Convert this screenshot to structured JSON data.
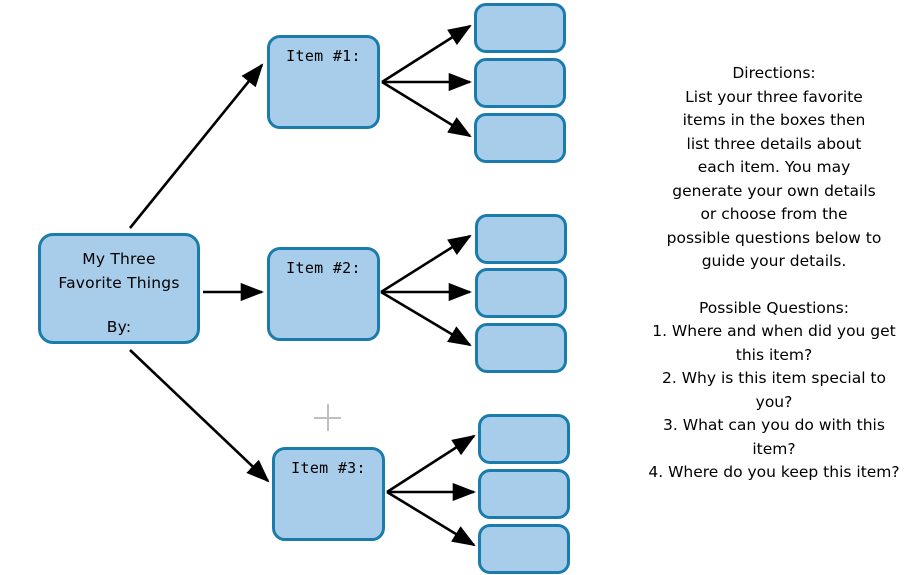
{
  "page": {
    "title": "My Three Favorite Things Graphic Organizer",
    "background_color": "#ffffff"
  },
  "theme": {
    "box_fill": "#a8cdea",
    "box_border": "#1b7cac",
    "arrow_color": "#000000",
    "crosshair_color": "#bfbfbf",
    "text_color": "#000000"
  },
  "organizer": {
    "main_box": {
      "title_lines": [
        "My Three",
        "Favorite Things"
      ],
      "byline": "By:"
    },
    "items": [
      {
        "label": "Item #1:",
        "details": [
          "",
          "",
          ""
        ]
      },
      {
        "label": "Item #2:",
        "details": [
          "",
          "",
          ""
        ]
      },
      {
        "label": "Item #3:",
        "details": [
          "",
          "",
          ""
        ]
      }
    ]
  },
  "instructions": {
    "directions_heading": "Directions:",
    "directions_lines": [
      "List your three favorite",
      "items in the boxes then",
      "list three details about",
      "each item.  You may",
      "generate your own details",
      "or choose from the",
      "possible questions below to",
      "guide your details."
    ],
    "questions_heading": "Possible Questions:",
    "questions": [
      "1.  Where and when did you get this item?",
      "2.  Why is this item special to you?",
      "3.  What can you do with this item?",
      "4.  Where do you keep this item?"
    ]
  }
}
